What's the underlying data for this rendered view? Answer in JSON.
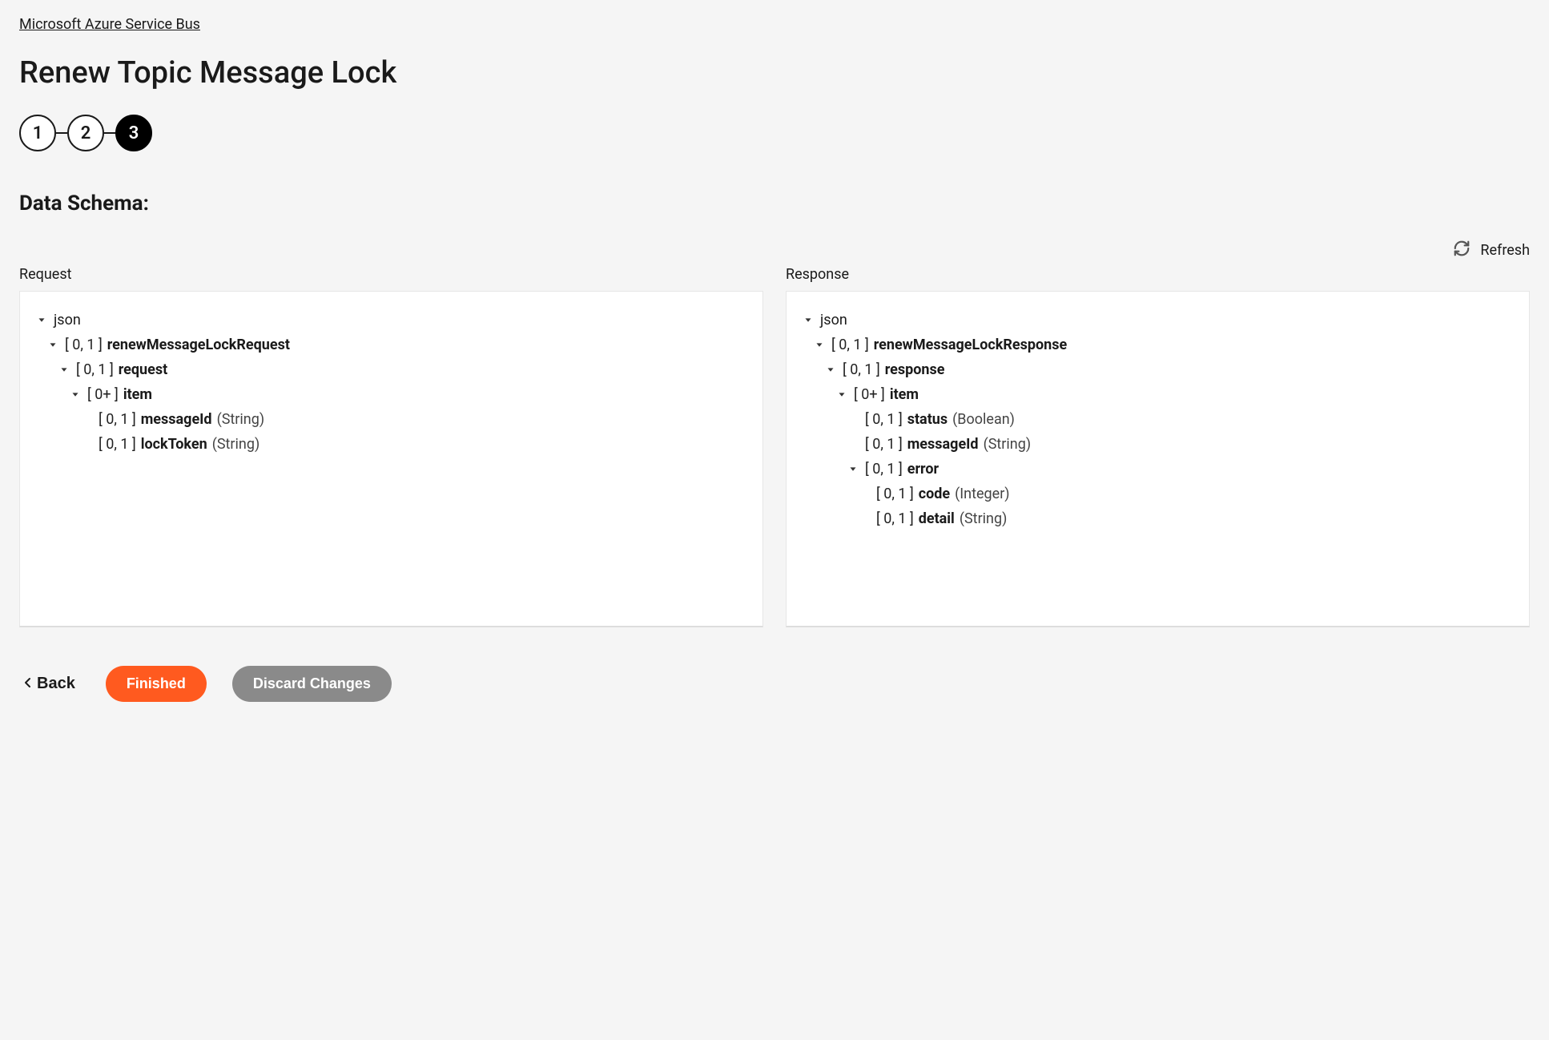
{
  "breadcrumb": "Microsoft Azure Service Bus",
  "page_title": "Renew Topic Message Lock",
  "stepper": {
    "steps": [
      "1",
      "2",
      "3"
    ],
    "active_index": 2
  },
  "section_title": "Data Schema:",
  "refresh_label": "Refresh",
  "panels": {
    "request_label": "Request",
    "response_label": "Response"
  },
  "request_tree": [
    {
      "indent": 0,
      "chevron": true,
      "card": "",
      "name": "json",
      "type": "",
      "name_bold": false
    },
    {
      "indent": 1,
      "chevron": true,
      "card": "[ 0, 1 ]",
      "name": "renewMessageLockRequest",
      "type": "",
      "name_bold": true
    },
    {
      "indent": 2,
      "chevron": true,
      "card": "[ 0, 1 ]",
      "name": "request",
      "type": "",
      "name_bold": true
    },
    {
      "indent": 3,
      "chevron": true,
      "card": "[ 0+ ]",
      "name": "item",
      "type": "",
      "name_bold": true
    },
    {
      "indent": 4,
      "chevron": false,
      "card": "[ 0, 1 ]",
      "name": "messageId",
      "type": "(String)",
      "name_bold": true
    },
    {
      "indent": 4,
      "chevron": false,
      "card": "[ 0, 1 ]",
      "name": "lockToken",
      "type": "(String)",
      "name_bold": true
    }
  ],
  "response_tree": [
    {
      "indent": 0,
      "chevron": true,
      "card": "",
      "name": "json",
      "type": "",
      "name_bold": false
    },
    {
      "indent": 1,
      "chevron": true,
      "card": "[ 0, 1 ]",
      "name": "renewMessageLockResponse",
      "type": "",
      "name_bold": true
    },
    {
      "indent": 2,
      "chevron": true,
      "card": "[ 0, 1 ]",
      "name": "response",
      "type": "",
      "name_bold": true
    },
    {
      "indent": 3,
      "chevron": true,
      "card": "[ 0+ ]",
      "name": "item",
      "type": "",
      "name_bold": true
    },
    {
      "indent": 4,
      "chevron": false,
      "card": "[ 0, 1 ]",
      "name": "status",
      "type": "(Boolean)",
      "name_bold": true
    },
    {
      "indent": 4,
      "chevron": false,
      "card": "[ 0, 1 ]",
      "name": "messageId",
      "type": "(String)",
      "name_bold": true
    },
    {
      "indent": 4,
      "chevron": true,
      "card": "[ 0, 1 ]",
      "name": "error",
      "type": "",
      "name_bold": true
    },
    {
      "indent": 5,
      "chevron": false,
      "card": "[ 0, 1 ]",
      "name": "code",
      "type": "(Integer)",
      "name_bold": true
    },
    {
      "indent": 5,
      "chevron": false,
      "card": "[ 0, 1 ]",
      "name": "detail",
      "type": "(String)",
      "name_bold": true
    }
  ],
  "footer": {
    "back": "Back",
    "finished": "Finished",
    "discard": "Discard Changes"
  }
}
